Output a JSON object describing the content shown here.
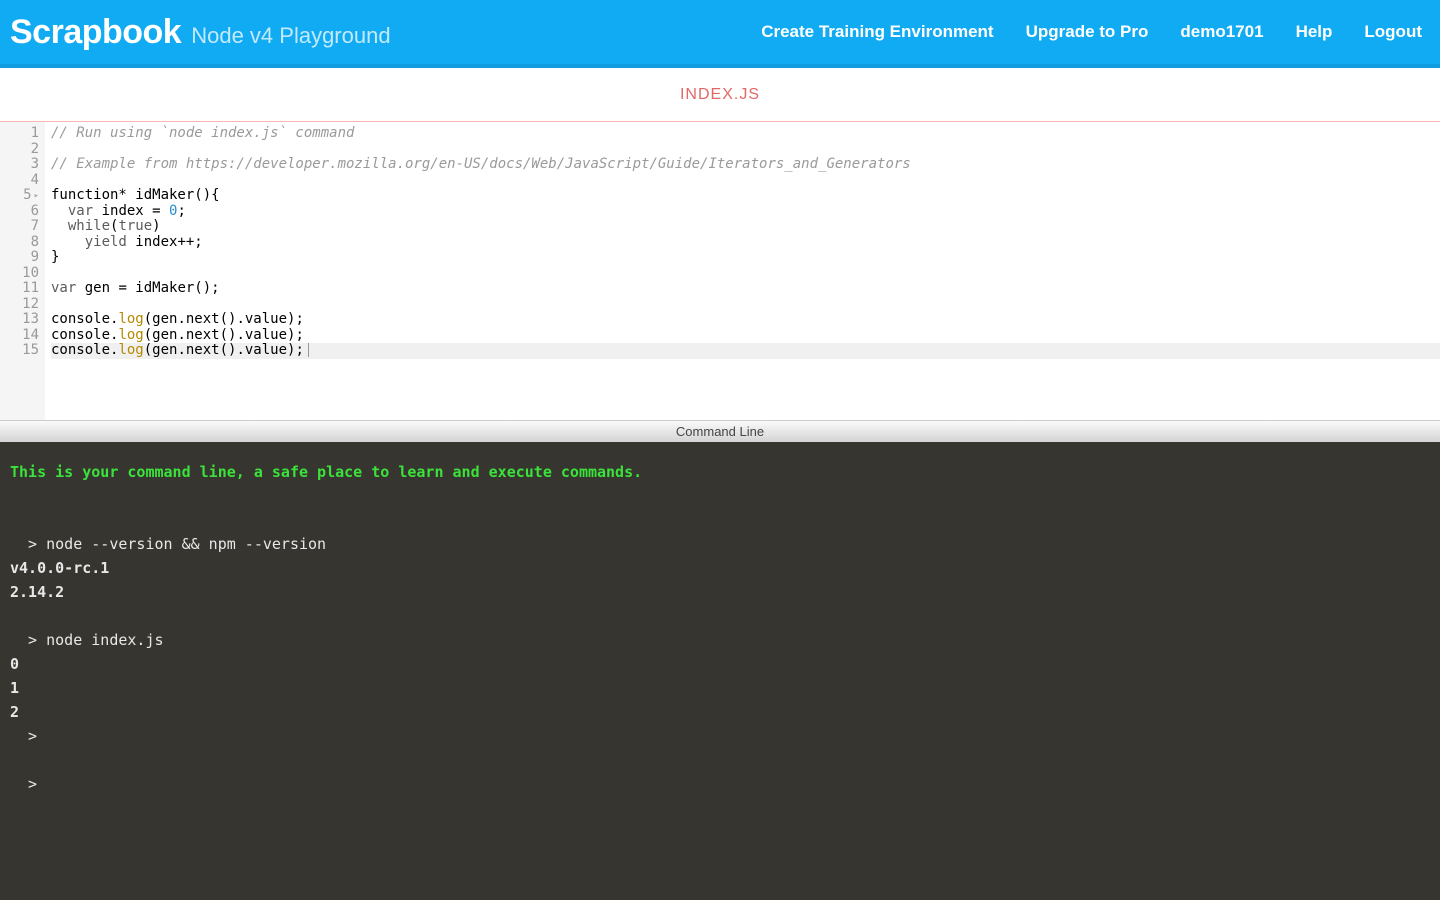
{
  "header": {
    "brand": "Scrapbook",
    "subtitle": "Node v4 Playground",
    "nav": {
      "create_env": "Create Training Environment",
      "upgrade": "Upgrade to Pro",
      "username": "demo1701",
      "help": "Help",
      "logout": "Logout"
    }
  },
  "editor": {
    "tab_label": "INDEX.JS",
    "active_line": 15,
    "fold_line": 5,
    "lines": [
      {
        "n": 1,
        "kind": "comment",
        "text": "// Run using `node index.js` command"
      },
      {
        "n": 2,
        "kind": "blank",
        "text": ""
      },
      {
        "n": 3,
        "kind": "comment",
        "text": "// Example from https://developer.mozilla.org/en-US/docs/Web/JavaScript/Guide/Iterators_and_Generators"
      },
      {
        "n": 4,
        "kind": "blank",
        "text": ""
      },
      {
        "n": 5,
        "kind": "code",
        "text": "function* idMaker(){"
      },
      {
        "n": 6,
        "kind": "code",
        "text": "  var index = 0;"
      },
      {
        "n": 7,
        "kind": "code",
        "text": "  while(true)"
      },
      {
        "n": 8,
        "kind": "code",
        "text": "    yield index++;"
      },
      {
        "n": 9,
        "kind": "code",
        "text": "}"
      },
      {
        "n": 10,
        "kind": "blank",
        "text": ""
      },
      {
        "n": 11,
        "kind": "code",
        "text": "var gen = idMaker();"
      },
      {
        "n": 12,
        "kind": "blank",
        "text": ""
      },
      {
        "n": 13,
        "kind": "code",
        "text": "console.log(gen.next().value);"
      },
      {
        "n": 14,
        "kind": "code",
        "text": "console.log(gen.next().value);"
      },
      {
        "n": 15,
        "kind": "code",
        "text": "console.log(gen.next().value);"
      }
    ]
  },
  "cli": {
    "header_label": "Command Line",
    "intro_message": "This is your command line, a safe place to learn and execute commands.",
    "prompt_prefix": "  > ",
    "entries": [
      {
        "type": "blank"
      },
      {
        "type": "blank"
      },
      {
        "type": "prompt",
        "text": "node --version && npm --version"
      },
      {
        "type": "output",
        "text": "v4.0.0-rc.1"
      },
      {
        "type": "output",
        "text": "2.14.2"
      },
      {
        "type": "blank"
      },
      {
        "type": "prompt",
        "text": "node index.js"
      },
      {
        "type": "output",
        "text": "0"
      },
      {
        "type": "output",
        "text": "1"
      },
      {
        "type": "output",
        "text": "2"
      },
      {
        "type": "prompt",
        "text": ""
      },
      {
        "type": "blank"
      },
      {
        "type": "prompt",
        "text": ""
      }
    ]
  }
}
